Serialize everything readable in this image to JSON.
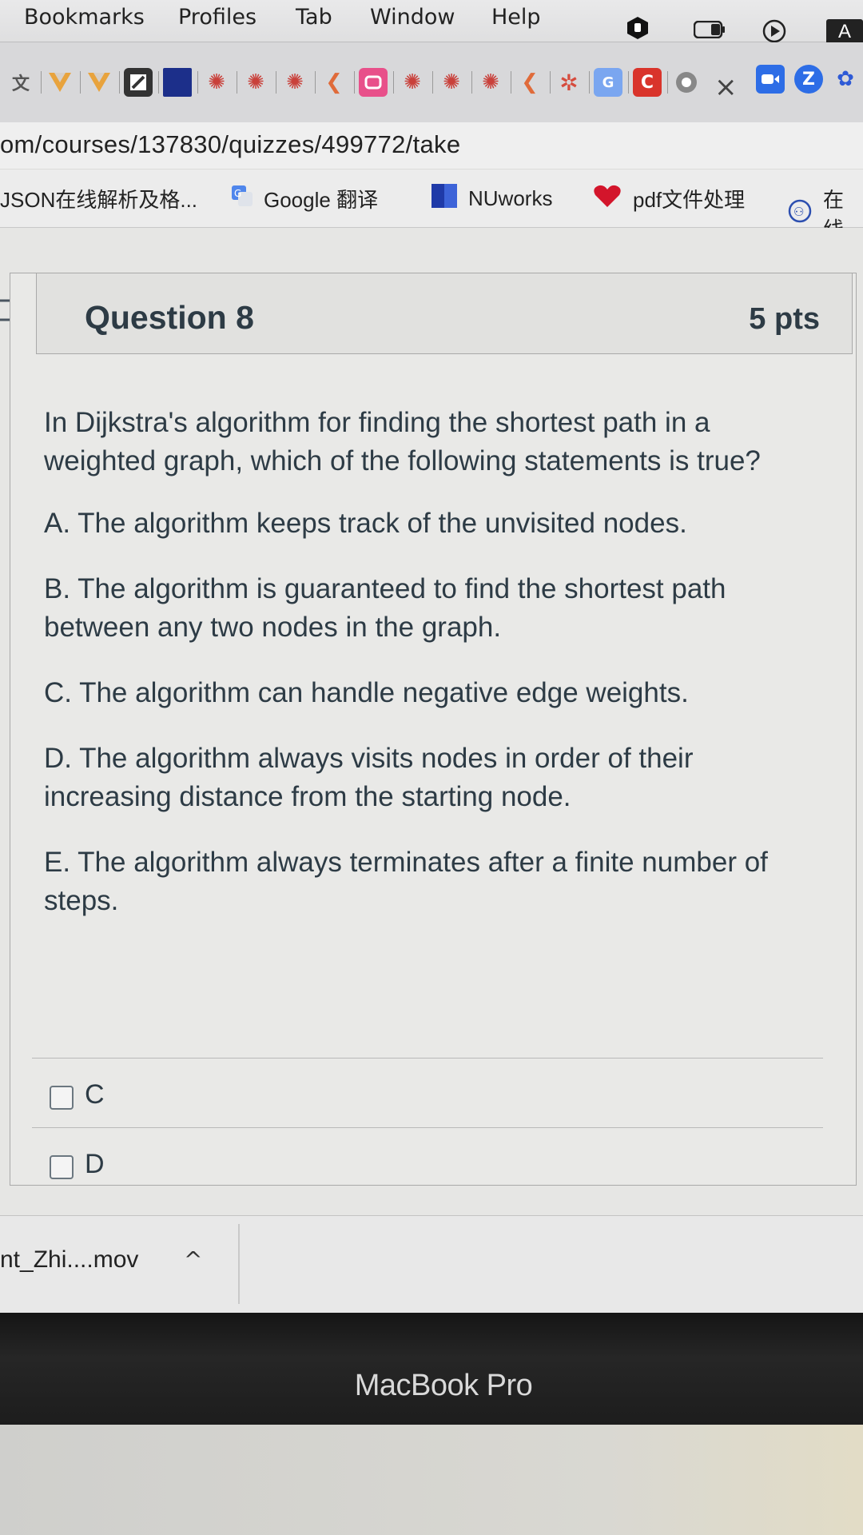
{
  "menu_bar": {
    "items": [
      "Bookmarks",
      "Profiles",
      "Tab",
      "Window",
      "Help"
    ],
    "status_a": "A"
  },
  "tab_strip": {
    "close_glyph": "×",
    "icons": [
      "translate-icon",
      "vue-icon",
      "vue-icon",
      "edit-icon",
      "blue-square-icon",
      "canvas-icon",
      "canvas-icon",
      "canvas-icon",
      "back-arrow-icon",
      "bilibili-icon",
      "canvas-icon",
      "canvas-icon",
      "canvas-icon",
      "back-arrow-icon",
      "loading-icon",
      "google-translate-icon",
      "c-icon",
      "chrome-icon",
      "zoom-icon",
      "z-icon",
      "baidu-icon"
    ]
  },
  "url": "om/courses/137830/quizzes/499772/take",
  "bookmarks": [
    {
      "label": "JSON在线解析及格...",
      "icon": "none"
    },
    {
      "label": "Google 翻译",
      "icon": "google-translate-icon"
    },
    {
      "label": "NUworks",
      "icon": "nuworks-icon"
    },
    {
      "label": "pdf文件处理",
      "icon": "heart-icon"
    },
    {
      "label": "在线",
      "icon": "circle-logo-icon"
    }
  ],
  "question": {
    "title": "Question 8",
    "points": "5 pts",
    "stem": "In Dijkstra's algorithm for finding the shortest path in a weighted graph, which of the following statements is true?",
    "options": [
      "A. The algorithm keeps track of the unvisited nodes.",
      "B. The algorithm is guaranteed to find the shortest path between any two nodes in the graph.",
      "C. The algorithm can handle negative edge weights.",
      "D. The algorithm always visits nodes in order of their increasing distance from the starting node.",
      "E. The algorithm always terminates after a finite number of steps."
    ],
    "answers": [
      {
        "label": "C",
        "checked": false
      },
      {
        "label": "D",
        "checked": false
      }
    ]
  },
  "downloads": {
    "file_name": "nt_Zhi....mov",
    "chevron": "^"
  },
  "bezel_label": "MacBook Pro"
}
